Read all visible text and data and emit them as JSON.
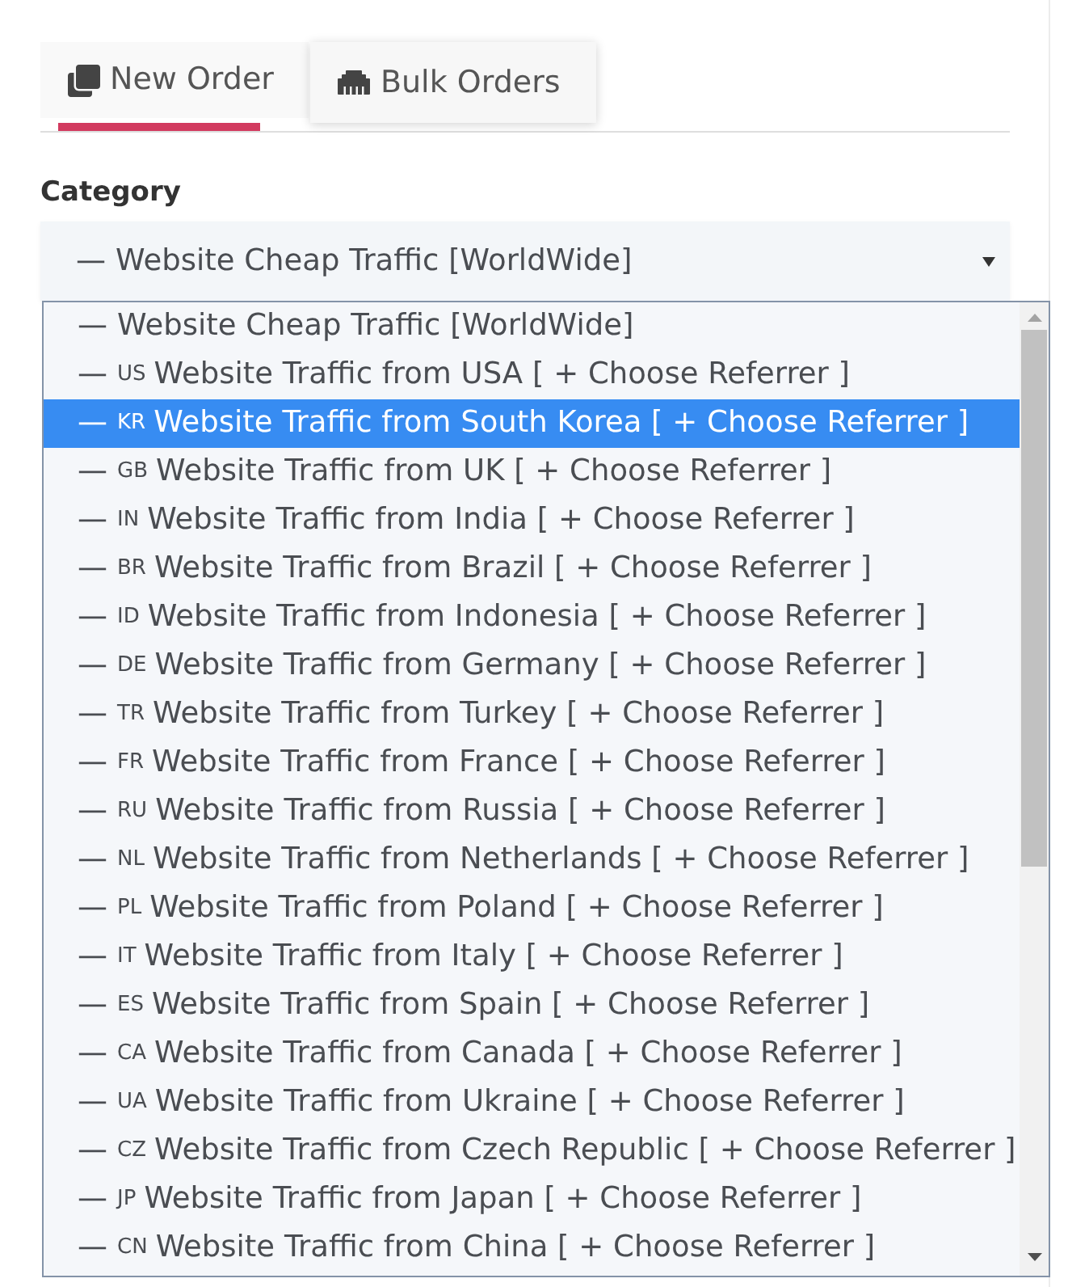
{
  "tabs": [
    {
      "label": "New Order",
      "selected": true
    },
    {
      "label": "Bulk Orders",
      "selected": false
    }
  ],
  "category": {
    "label": "Category",
    "select": {
      "marker": "—",
      "value": "Website Cheap Traffic [WorldWide]",
      "expanded": true
    },
    "options": [
      {
        "marker": "—",
        "label": "Website Cheap Traffic [WorldWide]",
        "selected": false
      },
      {
        "marker": "—",
        "code": "US",
        "label": "Website Traffic from USA [ + Choose Referrer ]",
        "selected": false
      },
      {
        "marker": "—",
        "code": "KR",
        "label": "Website Traffic from South Korea [ + Choose Referrer ]",
        "selected": true
      },
      {
        "marker": "—",
        "code": "GB",
        "label": "Website Traffic from UK [ + Choose Referrer ]",
        "selected": false
      },
      {
        "marker": "—",
        "code": "IN",
        "label": "Website Traffic from India [ + Choose Referrer ]",
        "selected": false
      },
      {
        "marker": "—",
        "code": "BR",
        "label": "Website Traffic from Brazil [ + Choose Referrer ]",
        "selected": false
      },
      {
        "marker": "—",
        "code": "ID",
        "label": "Website Traffic from Indonesia [ + Choose Referrer ]",
        "selected": false
      },
      {
        "marker": "—",
        "code": "DE",
        "label": "Website Traffic from Germany [ + Choose Referrer ]",
        "selected": false
      },
      {
        "marker": "—",
        "code": "TR",
        "label": "Website Traffic from Turkey [ + Choose Referrer ]",
        "selected": false
      },
      {
        "marker": "—",
        "code": "FR",
        "label": "Website Traffic from France [ + Choose Referrer ]",
        "selected": false
      },
      {
        "marker": "—",
        "code": "RU",
        "label": "Website Traffic from Russia [ + Choose Referrer ]",
        "selected": false
      },
      {
        "marker": "—",
        "code": "NL",
        "label": "Website Traffic from Netherlands [ + Choose Referrer ]",
        "selected": false
      },
      {
        "marker": "—",
        "code": "PL",
        "label": "Website Traffic from Poland [ + Choose Referrer ]",
        "selected": false
      },
      {
        "marker": "—",
        "code": "IT",
        "label": "Website Traffic from Italy [ + Choose Referrer ]",
        "selected": false
      },
      {
        "marker": "—",
        "code": "ES",
        "label": "Website Traffic from Spain [ + Choose Referrer ]",
        "selected": false
      },
      {
        "marker": "—",
        "code": "CA",
        "label": "Website Traffic from Canada [ + Choose Referrer ]",
        "selected": false
      },
      {
        "marker": "—",
        "code": "UA",
        "label": "Website Traffic from Ukraine [ + Choose Referrer ]",
        "selected": false
      },
      {
        "marker": "—",
        "code": "CZ",
        "label": "Website Traffic from Czech Republic [ + Choose Referrer ]",
        "selected": false
      },
      {
        "marker": "—",
        "code": "JP",
        "label": "Website Traffic from Japan [ + Choose Referrer ]",
        "selected": false
      },
      {
        "marker": "—",
        "code": "CN",
        "label": "Website Traffic from China [ + Choose Referrer ]",
        "selected": false
      }
    ]
  }
}
